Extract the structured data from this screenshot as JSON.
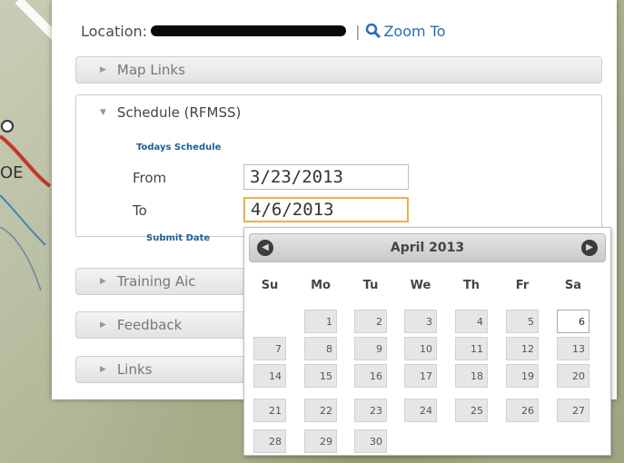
{
  "location": {
    "label": "Location:",
    "separator": "|",
    "zoom_label": "Zoom To"
  },
  "map_text": {
    "fragment": "OE"
  },
  "accordion": {
    "map_links": "Map Links",
    "schedule": "Schedule (RFMSS)",
    "training": "Training Aic",
    "feedback": "Feedback",
    "links": "Links"
  },
  "schedule": {
    "todays_link": "Todays Schedule",
    "from_label": "From",
    "from_value": "3/23/2013",
    "to_label": "To",
    "to_value": "4/6/2013",
    "submit_link": "Submit Date"
  },
  "calendar": {
    "title": "April 2013",
    "weekdays": [
      "Su",
      "Mo",
      "Tu",
      "We",
      "Th",
      "Fr",
      "Sa"
    ],
    "selected_day": "6",
    "days": [
      "1",
      "2",
      "3",
      "4",
      "5",
      "6",
      "7",
      "8",
      "9",
      "10",
      "11",
      "12",
      "13",
      "14",
      "15",
      "16",
      "17",
      "18",
      "19",
      "20",
      "21",
      "22",
      "23",
      "24",
      "25",
      "26",
      "27",
      "28",
      "29",
      "30"
    ]
  },
  "colors": {
    "link": "#1e5f9a",
    "focus_border": "#e3b34d",
    "trail": "#c0392b"
  }
}
